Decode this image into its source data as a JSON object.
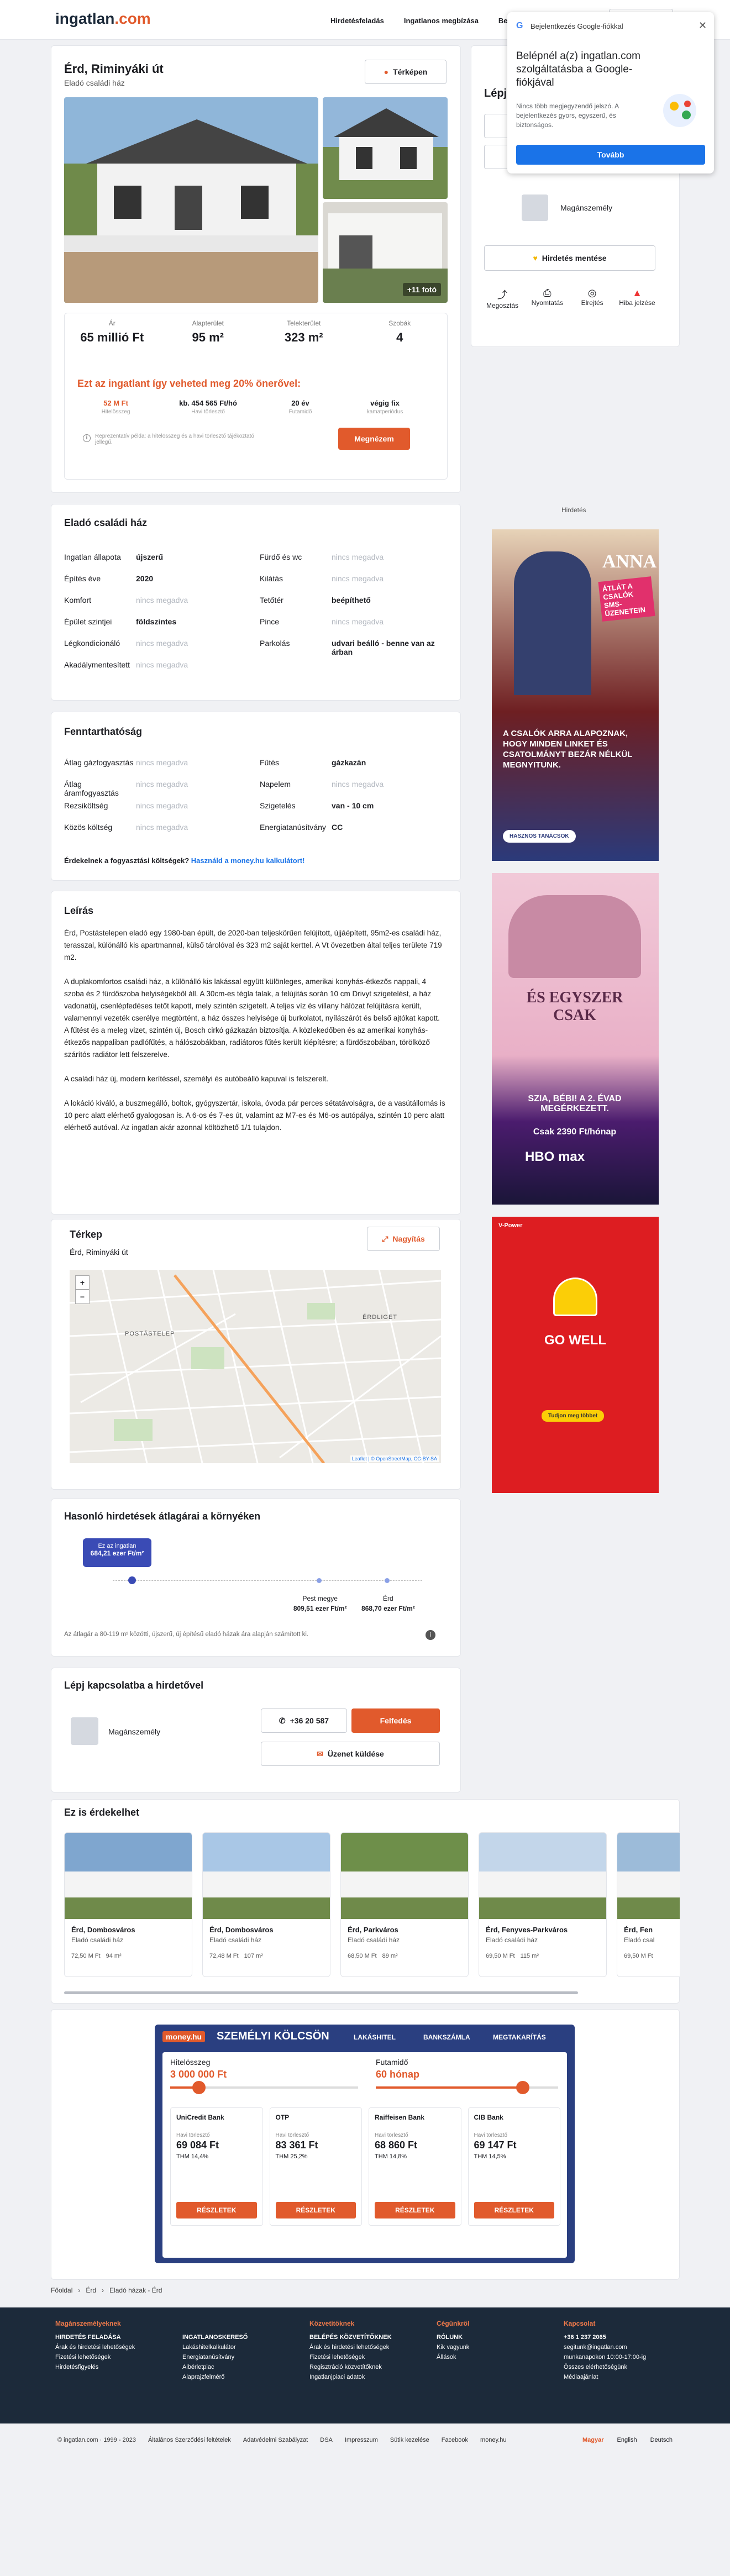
{
  "header": {
    "logo": "ingatlan",
    "logo_tld": ".com",
    "nav": [
      "Hirdetésfeladás",
      "Ingatlanos megbízása",
      "Bejelentkezés"
    ]
  },
  "google": {
    "title": "Bejelentkezés Google-fiókkal",
    "headline": "Belépnél a(z) ingatlan.com szolgáltatásba a Google-fiókjával",
    "body": "Nincs több megjegyzendő jelszó. A bejelentkezés gyors, egyszerű, és biztonságos.",
    "button": "Tovább"
  },
  "listing": {
    "title": "Érd, Riminyáki út",
    "subtitle": "Eladó családi ház",
    "map_button": "Térképen",
    "more_photos": "+11 fotó",
    "stats": [
      {
        "label": "Ár",
        "value": "65 millió Ft"
      },
      {
        "label": "Alapterület",
        "value": "95 m²"
      },
      {
        "label": "Telekterület",
        "value": "323 m²"
      },
      {
        "label": "Szobák",
        "value": "4"
      }
    ],
    "loan_title": "Ezt az ingatlant így veheted meg 20% önerővel:",
    "loan": [
      {
        "v": "52 M Ft",
        "l": "Hitelösszeg"
      },
      {
        "v": "kb. 454 565 Ft/hó",
        "l": "Havi törlesztő"
      },
      {
        "v": "20 év",
        "l": "Futamidő"
      },
      {
        "v": "végig fix",
        "l": "kamatperiódus"
      }
    ],
    "loan_note": "Reprezentatív példa: a hitelösszeg és a havi törlesztő tájékoztató jellegű.",
    "loan_button": "Megnézem"
  },
  "contact_side": {
    "title": "Lépj kapcsolatba",
    "person": "Magánszemély",
    "save": "Hirdetés mentése",
    "actions": [
      "Megosztás",
      "Nyomtatás",
      "Elrejtés",
      "Hiba jelzése"
    ]
  },
  "ad_label": "Hirdetés",
  "ads": {
    "anna_title": "ANNA",
    "anna_badge": "ÁTLÁT A CSALÓK SMS-ÜZENETEIN",
    "anna_text": "A CSALÓK ARRA ALAPOZNAK, HOGY MINDEN LINKET ÉS CSATOLMÁNYT BEZÁR NÉLKÜL MEGNYITUNK.",
    "anna_cta": "HASZNOS TANÁCSOK",
    "csak_title": "ÉS EGYSZER CSAK",
    "csak_sub": "SZIA, BÉBI! A 2. ÉVAD MEGÉRKEZETT.",
    "csak_price": "Csak 2390 Ft/hónap",
    "shell_title": "GO WELL",
    "shell_cta": "Tudjon meg többet"
  },
  "details": {
    "title": "Eladó családi ház",
    "left": [
      {
        "k": "Ingatlan állapota",
        "v": "újszerű"
      },
      {
        "k": "Építés éve",
        "v": "2020"
      },
      {
        "k": "Komfort",
        "v": "nincs megadva",
        "nm": true
      },
      {
        "k": "Épület szintjei",
        "v": "földszintes"
      },
      {
        "k": "Légkondicionáló",
        "v": "nincs megadva",
        "nm": true
      },
      {
        "k": "Akadálymentesített",
        "v": "nincs megadva",
        "nm": true
      }
    ],
    "right": [
      {
        "k": "Fürdő és wc",
        "v": "nincs megadva",
        "nm": true
      },
      {
        "k": "Kilátás",
        "v": "nincs megadva",
        "nm": true
      },
      {
        "k": "Tetőtér",
        "v": "beépíthető"
      },
      {
        "k": "Pince",
        "v": "nincs megadva",
        "nm": true
      },
      {
        "k": "Parkolás",
        "v": "udvari beálló - benne van az árban"
      }
    ]
  },
  "costs": {
    "title": "Fenntarthatóság",
    "left": [
      {
        "k": "Átlag gázfogyasztás",
        "v": "nincs megadva"
      },
      {
        "k": "Átlag áramfogyasztás",
        "v": "nincs megadva"
      },
      {
        "k": "Rezsiköltség",
        "v": "nincs megadva"
      },
      {
        "k": "Közös költség",
        "v": "nincs megadva"
      }
    ],
    "right": [
      {
        "k": "Fűtés",
        "v": "gázkazán",
        "b": true
      },
      {
        "k": "Napelem",
        "v": "nincs megadva"
      },
      {
        "k": "Szigetelés",
        "v": "van - 10 cm",
        "b": true
      },
      {
        "k": "Energiatanúsítvány",
        "v": "CC",
        "b": true
      }
    ],
    "note": "Érdekelnek a fogyasztási költségek?",
    "link": "Használd a money.hu kalkulátort!"
  },
  "description": {
    "title": "Leírás",
    "paras": [
      "Érd, Postástelepen eladó egy 1980-ban épült, de 2020-ban teljeskörűen felújított, újjáépített, 95m2-es családi ház, terasszal, különálló kis apartmannal, külső tárolóval és 323 m2 saját kerttel. A Vt övezetben által teljes területe 719 m2.",
      "A duplakomfortos családi ház, a különálló kis lakással együtt különleges, amerikai konyhás-étkezős nappali, 4 szoba és 2 fürdőszoba helyiségekből áll. A 30cm-es tégla falak, a felújítás során 10 cm Drivyt szigetelést, a ház vadonatúj, csenlépfedéses tetőt kapott, mely szintén szigetelt. A teljes víz és villany hálózat felújításra került, valamennyi vezeték cserélye megtörtént, a ház összes helyisége új burkolatot, nyílászárót és belső ajtókat kapott. A fűtést és a meleg vizet, szintén új, Bosch cirkó gázkazán biztosítja. A közlekedőben és az amerikai konyhás-étkezős nappaliban padlófűtés, a hálószobákban, radiátoros fűtés került kiépítésre; a fürdőszobában, törölköző szárítós radiátor lett felszerelve.",
      "A családi ház új, modern kerítéssel, személyi és autóbeálló kapuval is felszerelt.",
      "A lokáció kiváló, a buszmegálló, boltok, gyógyszertár, iskola, óvoda pár perces sétatávolságra, de a vasútállomás is 10 perc alatt elérhető gyalogosan is. A 6-os és 7-es út, valamint az M7-es és M6-os autópálya, szintén 10 perc alatt elérhető autóval. Az ingatlan akár azonnal költözhető 1/1 tulajdon."
    ]
  },
  "map": {
    "title": "Térkep",
    "address": "Érd, Riminyáki út",
    "enlarge": "Nagyítás",
    "zoom_in": "+",
    "zoom_out": "−",
    "attrib": "Leaflet | © OpenStreetMap, CC-BY-SA",
    "labels": [
      "POSTÁSTELEP",
      "ÉRDLIGET"
    ]
  },
  "price_compare": {
    "title": "Hasonló hirdetések átlagárai a környéken",
    "current_label": "Ez az ingatlan",
    "current_value": "684,21 ezer Ft/m²",
    "points": [
      {
        "l": "Pest megye",
        "v": "809,51 ezer Ft/m²"
      },
      {
        "l": "Érd",
        "v": "868,70 ezer Ft/m²"
      }
    ],
    "note": "Az átlagár a 80-119 m² közötti, újszerű, új építésű eladó házak ára alapján számított ki.",
    "positions": [
      0.06,
      0.67,
      0.89
    ]
  },
  "contact": {
    "title": "Lépj kapcsolatba a hirdetővel",
    "person": "Magánszemély",
    "phone": "+36 20 587",
    "show": "Felfedés",
    "message": "Üzenet küldése"
  },
  "similar": {
    "title": "Ez is érdekelhet",
    "items": [
      {
        "t": "Érd, Dombosváros",
        "s": "Eladó családi ház",
        "p": "72,50 M Ft",
        "a": "94 m²"
      },
      {
        "t": "Érd, Dombosváros",
        "s": "Eladó családi ház",
        "p": "72,48 M Ft",
        "a": "107 m²"
      },
      {
        "t": "Érd, Parkváros",
        "s": "Eladó családi ház",
        "p": "68,50 M Ft",
        "a": "89 m²"
      },
      {
        "t": "Érd, Fenyves-Parkváros",
        "s": "Eladó családi ház",
        "p": "69,50 M Ft",
        "a": "115 m²"
      },
      {
        "t": "Érd, Fen",
        "s": "Eladó csal",
        "p": "69,50 M Ft",
        "a": ""
      }
    ]
  },
  "money": {
    "brand": "money.hu",
    "title": "SZEMÉLYI KÖLCSÖN",
    "tabs": [
      "LAKÁSHITEL",
      "BANKSZÁMLA",
      "MEGTAKARÍTÁS"
    ],
    "amount_label": "Hitelösszeg",
    "amount": "3 000 000 Ft",
    "term_label": "Futamidő",
    "term": "60 hónap",
    "banks": [
      {
        "n": "UniCredit Bank",
        "v": "69 084 Ft",
        "t": "THM 14,4%"
      },
      {
        "n": "OTP",
        "v": "83 361 Ft",
        "t": "THM 25,2%"
      },
      {
        "n": "Raiffeisen Bank",
        "v": "68 860 Ft",
        "t": "THM 14,8%"
      },
      {
        "n": "CIB Bank",
        "v": "69 147 Ft",
        "t": "THM 14,5%"
      }
    ],
    "monthly": "Havi törlesztő",
    "details": "RÉSZLETEK"
  },
  "breadcrumb": [
    "Főoldal",
    "Érd",
    "Eladó házak - Érd"
  ],
  "footer": {
    "cols": [
      {
        "h": "Magánszemélyeknek",
        "items": [
          "HIRDETÉS FELADÁSA",
          "Árak és hirdetési lehetőségek",
          "Fizetési lehetőségek",
          "Hirdetésfigyelés"
        ]
      },
      {
        "h": "",
        "items": [
          "INGATLANOSKERESŐ",
          "Lakáshitelkalkulátor",
          "Energiatanúsítvány",
          "Albérletpiac",
          "Alaprajzfelmérő"
        ]
      },
      {
        "h": "Közvetítőknek",
        "items": [
          "BELÉPÉS KÖZVETÍTŐKNEK",
          "Árak és hirdetési lehetőségek",
          "Fizetési lehetőségek",
          "Regisztráció közvetítőknek",
          "Ingatlanjpiaci adatok"
        ]
      },
      {
        "h": "Cégünkről",
        "items": [
          "RÓLUNK",
          "Kik vagyunk",
          "Állások"
        ]
      },
      {
        "h": "Kapcsolat",
        "items": [
          "+36 1 237 2065",
          "segitunk@ingatlan.com",
          "munkanapokon 10:00-17:00-ig",
          "Összes elérhetőségünk",
          "Médiaajánlat"
        ]
      }
    ],
    "bottom": [
      "© ingatlan.com · 1999 - 2023",
      "Általános Szerződési feltételek",
      "Adatvédelmi Szabályzat",
      "DSA",
      "Impresszum",
      "Sütik kezelése",
      "Facebook",
      "money.hu"
    ],
    "langs": [
      "Magyar",
      "English",
      "Deutsch"
    ]
  },
  "colors": {
    "brand": "#e15a2c",
    "navy": "#1c2a3a",
    "link": "#1a73e8"
  }
}
